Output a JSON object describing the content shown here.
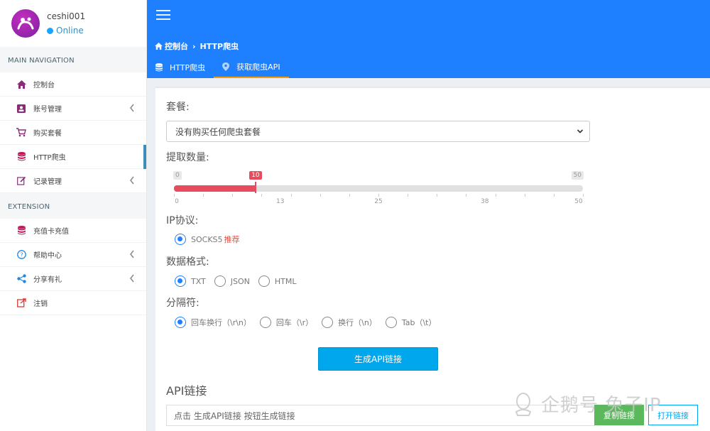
{
  "user": {
    "name": "ceshi001",
    "status": "Online"
  },
  "nav": {
    "main_header": "MAIN NAVIGATION",
    "main_items": [
      {
        "label": "控制台",
        "icon": "home-icon"
      },
      {
        "label": "账号管理",
        "icon": "id-card-icon"
      },
      {
        "label": "购买套餐",
        "icon": "cart-icon"
      },
      {
        "label": "HTTP爬虫",
        "icon": "database-icon"
      },
      {
        "label": "记录管理",
        "icon": "edit-icon"
      }
    ],
    "ext_header": "EXTENSION",
    "ext_items": [
      {
        "label": "充值卡充值",
        "icon": "database-icon"
      },
      {
        "label": "帮助中心",
        "icon": "question-icon"
      },
      {
        "label": "分享有礼",
        "icon": "share-icon"
      },
      {
        "label": "注销",
        "icon": "logout-icon"
      }
    ]
  },
  "breadcrumb": {
    "home": "控制台",
    "current": "HTTP爬虫"
  },
  "tabs": [
    {
      "label": "HTTP爬虫"
    },
    {
      "label": "获取爬虫API"
    }
  ],
  "form": {
    "package_label": "套餐:",
    "package_value": "没有购买任何爬虫套餐",
    "quantity_label": "提取数量:",
    "slider": {
      "min": "0",
      "max": "50",
      "value": "10",
      "ticks": [
        "0",
        "13",
        "25",
        "38",
        "50"
      ]
    },
    "protocol_label": "IP协议:",
    "protocol_option": "SOCKS5",
    "protocol_recommend": "推荐",
    "format_label": "数据格式:",
    "format_options": [
      "TXT",
      "JSON",
      "HTML"
    ],
    "separator_label": "分隔符:",
    "separator_options": [
      "回车换行（\\r\\n）",
      "回车（\\r）",
      "换行（\\n）",
      "Tab（\\t）"
    ],
    "generate_button": "生成API链接",
    "api_title": "API链接",
    "api_placeholder": "点击 生成API链接 按钮生成链接",
    "copy_button": "复制链接",
    "open_button": "打开链接"
  },
  "watermark": "企鹅号 兔子IP",
  "colors": {
    "header": "#1e7fff",
    "accent": "#00a7ec",
    "slider": "#e74c5e",
    "tab_indicator": "#f39c12"
  }
}
